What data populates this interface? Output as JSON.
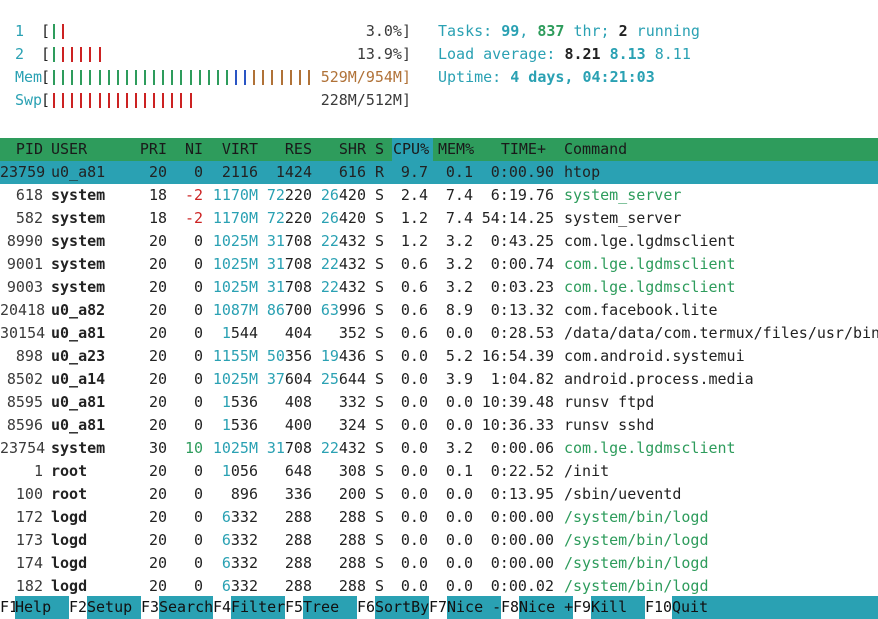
{
  "meters": [
    {
      "label": "1",
      "value": "3.0%]",
      "fill": 0.03,
      "ticks": [
        {
          "c": "#2e9c5c"
        },
        {
          "c": "#cc2222"
        }
      ]
    },
    {
      "label": "2",
      "value": "13.9%]",
      "fill": 0.139,
      "ticks": [
        {
          "c": "#2e9c5c"
        },
        {
          "c": "#cc2222"
        },
        {
          "c": "#cc2222"
        },
        {
          "c": "#cc2222"
        },
        {
          "c": "#cc2222"
        },
        {
          "c": "#cc2222"
        }
      ]
    },
    {
      "label": "Mem",
      "value": "529M/954M]",
      "fill": 0.554,
      "ticks_green": 20,
      "ticks_blue": 2,
      "ticks_orange": 7
    },
    {
      "label": "Swp",
      "value": "228M/512M]",
      "fill": 0.445,
      "ticks_red": 16
    }
  ],
  "bracket_open": "[",
  "summary": {
    "tasks_label": "Tasks: ",
    "tasks": "99",
    "sep": ", ",
    "threads": "837",
    "thr_label": " thr; ",
    "running": "2",
    "running_label": " running",
    "load_label": "Load average: ",
    "load1": "8.21",
    "load5": "8.13",
    "load15": "8.11",
    "uptime_label": "Uptime: ",
    "uptime": "4 days, 04:21:03"
  },
  "columns": {
    "pid": "PID",
    "user": "USER",
    "pri": "PRI",
    "ni": "NI",
    "virt": "VIRT",
    "res": "RES",
    "shr": "SHR",
    "s": "S",
    "cpu": "CPU%",
    "mem": "MEM%",
    "time": "TIME+",
    "command": "Command"
  },
  "processes": [
    {
      "pid": "23759",
      "user": "u0_a81",
      "pri": "20",
      "ni": "0",
      "virt": "2116",
      "res_a": "1424",
      "res_b": "",
      "shr_a": "616",
      "shr_b": "",
      "s": "R",
      "cpu": "9.7",
      "mem": "0.1",
      "time": "0:00.90",
      "command": "htop",
      "selected": true
    },
    {
      "pid": "618",
      "user": "system",
      "pri": "18",
      "ni": "-2",
      "virt": "1170M",
      "res_a": "72",
      "res_b": "220",
      "shr_a": "26",
      "shr_b": "420",
      "s": "S",
      "cpu": "2.4",
      "mem": "7.4",
      "time": "6:19.76",
      "command": "system_server",
      "thread": true
    },
    {
      "pid": "582",
      "user": "system",
      "pri": "18",
      "ni": "-2",
      "virt": "1170M",
      "res_a": "72",
      "res_b": "220",
      "shr_a": "26",
      "shr_b": "420",
      "s": "S",
      "cpu": "1.2",
      "mem": "7.4",
      "time": "54:14.25",
      "command": "system_server"
    },
    {
      "pid": "8990",
      "user": "system",
      "pri": "20",
      "ni": "0",
      "virt": "1025M",
      "res_a": "31",
      "res_b": "708",
      "shr_a": "22",
      "shr_b": "432",
      "s": "S",
      "cpu": "1.2",
      "mem": "3.2",
      "time": "0:43.25",
      "command": "com.lge.lgdmsclient"
    },
    {
      "pid": "9001",
      "user": "system",
      "pri": "20",
      "ni": "0",
      "virt": "1025M",
      "res_a": "31",
      "res_b": "708",
      "shr_a": "22",
      "shr_b": "432",
      "s": "S",
      "cpu": "0.6",
      "mem": "3.2",
      "time": "0:00.74",
      "command": "com.lge.lgdmsclient",
      "thread": true
    },
    {
      "pid": "9003",
      "user": "system",
      "pri": "20",
      "ni": "0",
      "virt": "1025M",
      "res_a": "31",
      "res_b": "708",
      "shr_a": "22",
      "shr_b": "432",
      "s": "S",
      "cpu": "0.6",
      "mem": "3.2",
      "time": "0:03.23",
      "command": "com.lge.lgdmsclient",
      "thread": true
    },
    {
      "pid": "20418",
      "user": "u0_a82",
      "pri": "20",
      "ni": "0",
      "virt": "1087M",
      "res_a": "86",
      "res_b": "700",
      "shr_a": "63",
      "shr_b": "996",
      "s": "S",
      "cpu": "0.6",
      "mem": "8.9",
      "time": "0:13.32",
      "command": "com.facebook.lite"
    },
    {
      "pid": "30154",
      "user": "u0_a81",
      "pri": "20",
      "ni": "0",
      "virt": "1544",
      "res_a": "404",
      "res_b": "",
      "shr_a": "352",
      "shr_b": "",
      "s": "S",
      "cpu": "0.6",
      "mem": "0.0",
      "time": "0:28.53",
      "command": "/data/data/com.termux/files/usr/bin",
      "virt_small": true
    },
    {
      "pid": "898",
      "user": "u0_a23",
      "pri": "20",
      "ni": "0",
      "virt": "1155M",
      "res_a": "50",
      "res_b": "356",
      "shr_a": "19",
      "shr_b": "436",
      "s": "S",
      "cpu": "0.0",
      "mem": "5.2",
      "time": "16:54.39",
      "command": "com.android.systemui"
    },
    {
      "pid": "8502",
      "user": "u0_a14",
      "pri": "20",
      "ni": "0",
      "virt": "1025M",
      "res_a": "37",
      "res_b": "604",
      "shr_a": "25",
      "shr_b": "644",
      "s": "S",
      "cpu": "0.0",
      "mem": "3.9",
      "time": "1:04.82",
      "command": "android.process.media"
    },
    {
      "pid": "8595",
      "user": "u0_a81",
      "pri": "20",
      "ni": "0",
      "virt": "1536",
      "res_a": "408",
      "res_b": "",
      "shr_a": "332",
      "shr_b": "",
      "s": "S",
      "cpu": "0.0",
      "mem": "0.0",
      "time": "10:39.48",
      "command": "runsv ftpd",
      "virt_small": true
    },
    {
      "pid": "8596",
      "user": "u0_a81",
      "pri": "20",
      "ni": "0",
      "virt": "1536",
      "res_a": "400",
      "res_b": "",
      "shr_a": "324",
      "shr_b": "",
      "s": "S",
      "cpu": "0.0",
      "mem": "0.0",
      "time": "10:36.33",
      "command": "runsv sshd",
      "virt_small": true
    },
    {
      "pid": "23754",
      "user": "system",
      "pri": "30",
      "ni": "10",
      "virt": "1025M",
      "res_a": "31",
      "res_b": "708",
      "shr_a": "22",
      "shr_b": "432",
      "s": "S",
      "cpu": "0.0",
      "mem": "3.2",
      "time": "0:00.06",
      "command": "com.lge.lgdmsclient",
      "thread": true,
      "ni_green": true
    },
    {
      "pid": "1",
      "user": "root",
      "pri": "20",
      "ni": "0",
      "virt": "1056",
      "res_a": "648",
      "res_b": "",
      "shr_a": "308",
      "shr_b": "",
      "s": "S",
      "cpu": "0.0",
      "mem": "0.1",
      "time": "0:22.52",
      "command": "/init",
      "virt_small": true
    },
    {
      "pid": "100",
      "user": "root",
      "pri": "20",
      "ni": "0",
      "virt": "896",
      "res_a": "336",
      "res_b": "",
      "shr_a": "200",
      "shr_b": "",
      "s": "S",
      "cpu": "0.0",
      "mem": "0.0",
      "time": "0:13.95",
      "command": "/sbin/ueventd"
    },
    {
      "pid": "172",
      "user": "logd",
      "pri": "20",
      "ni": "0",
      "virt": "6332",
      "res_a": "288",
      "res_b": "",
      "shr_a": "288",
      "shr_b": "",
      "s": "S",
      "cpu": "0.0",
      "mem": "0.0",
      "time": "0:00.00",
      "command": "/system/bin/logd",
      "thread": true,
      "virt_small": true
    },
    {
      "pid": "173",
      "user": "logd",
      "pri": "20",
      "ni": "0",
      "virt": "6332",
      "res_a": "288",
      "res_b": "",
      "shr_a": "288",
      "shr_b": "",
      "s": "S",
      "cpu": "0.0",
      "mem": "0.0",
      "time": "0:00.00",
      "command": "/system/bin/logd",
      "thread": true,
      "virt_small": true
    },
    {
      "pid": "174",
      "user": "logd",
      "pri": "20",
      "ni": "0",
      "virt": "6332",
      "res_a": "288",
      "res_b": "",
      "shr_a": "288",
      "shr_b": "",
      "s": "S",
      "cpu": "0.0",
      "mem": "0.0",
      "time": "0:00.00",
      "command": "/system/bin/logd",
      "thread": true,
      "virt_small": true
    },
    {
      "pid": "182",
      "user": "logd",
      "pri": "20",
      "ni": "0",
      "virt": "6332",
      "res_a": "288",
      "res_b": "",
      "shr_a": "288",
      "shr_b": "",
      "s": "S",
      "cpu": "0.0",
      "mem": "0.0",
      "time": "0:00.02",
      "command": "/system/bin/logd",
      "thread": true,
      "virt_small": true
    }
  ],
  "footer": [
    {
      "key": "F1",
      "label": "Help  "
    },
    {
      "key": "F2",
      "label": "Setup "
    },
    {
      "key": "F3",
      "label": "Search"
    },
    {
      "key": "F4",
      "label": "Filter"
    },
    {
      "key": "F5",
      "label": "Tree  "
    },
    {
      "key": "F6",
      "label": "SortBy"
    },
    {
      "key": "F7",
      "label": "Nice -"
    },
    {
      "key": "F8",
      "label": "Nice +"
    },
    {
      "key": "F9",
      "label": "Kill  "
    },
    {
      "key": "F10",
      "label": "Quit      "
    }
  ],
  "colors": {
    "cyan": "#2aa1b3",
    "green": "#2e9c5c",
    "red": "#cc2222",
    "orange": "#b07238",
    "blue": "#2a55c4"
  }
}
